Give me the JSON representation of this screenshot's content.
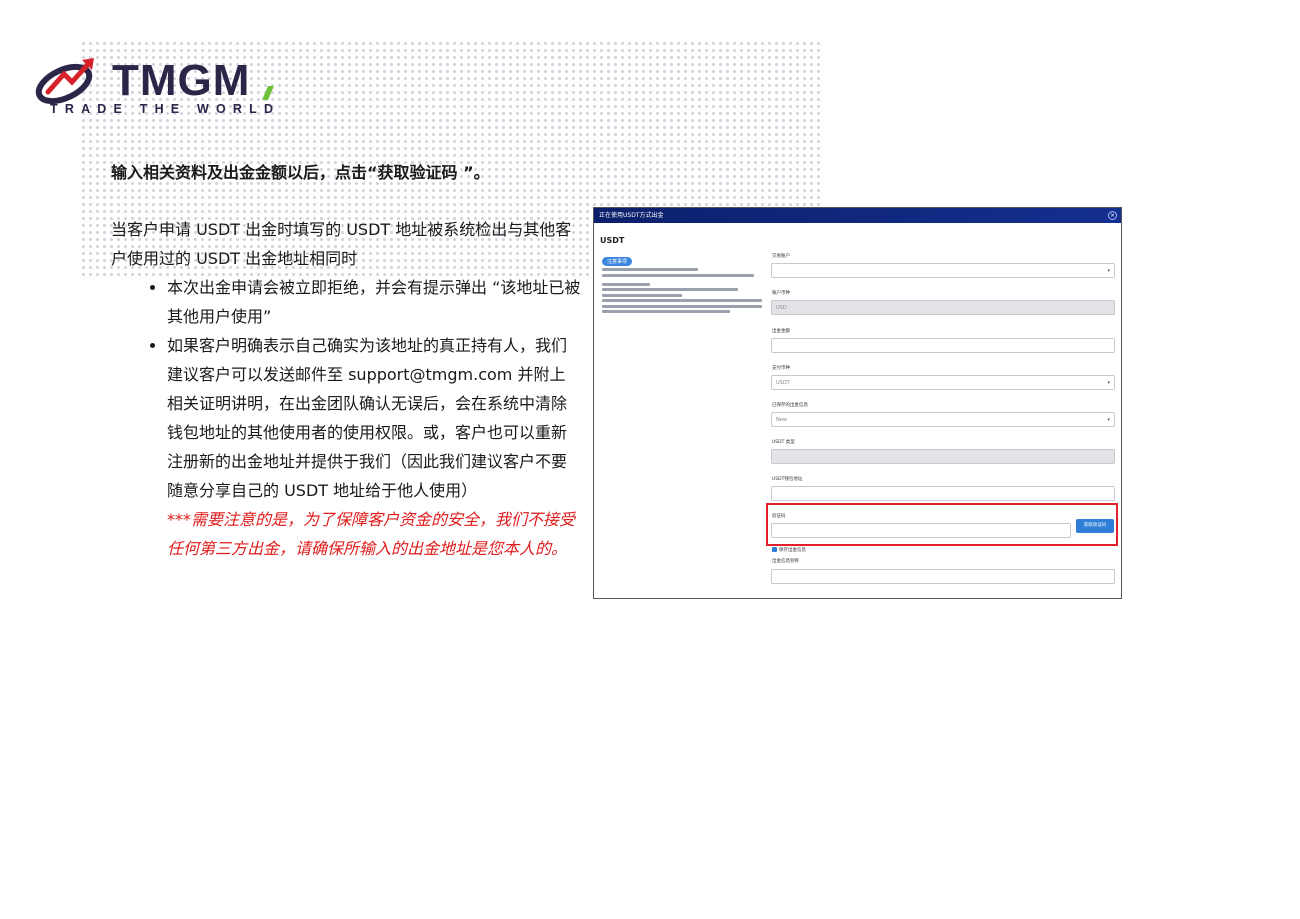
{
  "brand": {
    "name": "TMGM",
    "tagline": "TRADE THE WORLD",
    "colors": {
      "primary": "#2b2548",
      "accent": "#6dc23a"
    }
  },
  "doc": {
    "heading": "输入相关资料及出金金额以后，点击“获取验证码 ”。",
    "intro": "当客户申请 USDT 出金时填写的 USDT 地址被系统检出与其他客户使用过的 USDT 出金地址相同时",
    "bullets": [
      "本次出金申请会被立即拒绝，并会有提示弹出 “该地址已被其他用户使用”",
      "如果客户明确表示自己确实为该地址的真正持有人，我们建议客户可以发送邮件至 support@tmgm.com 并附上相关证明讲明，在出金团队确认无误后，会在系统中清除钱包地址的其他使用者的使用权限。或，客户也可以重新注册新的出金地址并提供于我们（因此我们建议客户不要随意分享自己的 USDT 地址给于他人使用）"
    ],
    "warning": "***需要注意的是，为了保障客户资金的安全，我们不接受任何第三方出金，请确保所输入的出金地址是您本人的。",
    "warning_color": "#e01b1b"
  },
  "screenshot": {
    "window_title": "正在使用USDT方式出金",
    "section_title": "USDT",
    "notice_tag": "注意事项",
    "fields": [
      {
        "label": "交易账户",
        "value": "",
        "select": true,
        "grey": false
      },
      {
        "label": "账户币种",
        "value": "USD",
        "select": false,
        "grey": true
      },
      {
        "label": "出金金额",
        "value": "",
        "select": false,
        "grey": false
      },
      {
        "label": "支付币种",
        "value": "USDT",
        "select": true,
        "grey": false
      },
      {
        "label": "已保存的出金信息",
        "value": "New",
        "select": true,
        "grey": false
      },
      {
        "label": "USDT 类型",
        "value": "",
        "select": false,
        "grey": true
      },
      {
        "label": "USDT钱包地址",
        "value": "",
        "select": false,
        "grey": false
      },
      {
        "label": "验证码",
        "value": "",
        "select": false,
        "grey": false
      }
    ],
    "get_code_button": "获取验证码",
    "save_checkbox": "保存出金信息",
    "last_field_label": "出金信息别称"
  }
}
